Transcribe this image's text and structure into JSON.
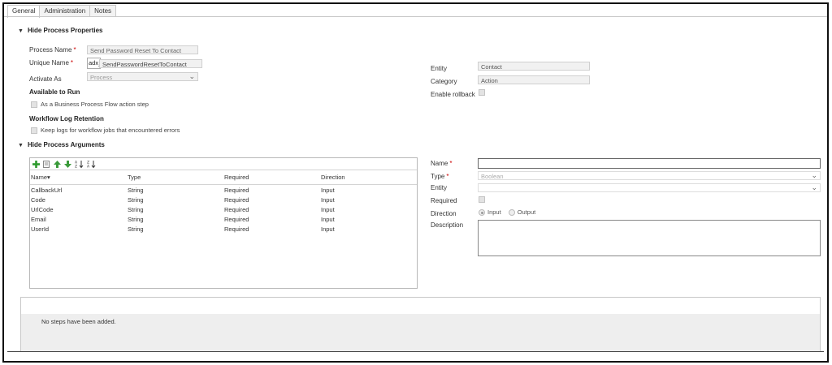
{
  "tabs": [
    {
      "label": "General"
    },
    {
      "label": "Administration"
    },
    {
      "label": "Notes"
    }
  ],
  "properties": {
    "header": "Hide Process Properties",
    "process_name": {
      "label": "Process Name",
      "value": "Send Password Reset To Contact"
    },
    "unique_name": {
      "label": "Unique Name",
      "prefix": "adx_",
      "value": "SendPasswordResetToContact"
    },
    "activate_as": {
      "label": "Activate As",
      "value": "Process"
    },
    "available_to_run": {
      "header": "Available to Run",
      "option": "As a Business Process Flow action step"
    },
    "workflow_log": {
      "header": "Workflow Log Retention",
      "option": "Keep logs for workflow jobs that encountered errors"
    },
    "entity": {
      "label": "Entity",
      "value": "Contact"
    },
    "category": {
      "label": "Category",
      "value": "Action"
    },
    "enable_rollback": {
      "label": "Enable rollback"
    }
  },
  "arguments": {
    "header": "Hide Process Arguments",
    "columns": [
      "Name",
      "Type",
      "Required",
      "Direction"
    ],
    "rows": [
      {
        "name": "CallbackUrl",
        "type": "String",
        "required": "Required",
        "direction": "Input"
      },
      {
        "name": "Code",
        "type": "String",
        "required": "Required",
        "direction": "Input"
      },
      {
        "name": "UrlCode",
        "type": "String",
        "required": "Required",
        "direction": "Input"
      },
      {
        "name": "Email",
        "type": "String",
        "required": "Required",
        "direction": "Input"
      },
      {
        "name": "UserId",
        "type": "String",
        "required": "Required",
        "direction": "Input"
      }
    ]
  },
  "detail": {
    "name_label": "Name",
    "type_label": "Type",
    "type_value": "Boolean",
    "entity_label": "Entity",
    "required_label": "Required",
    "direction_label": "Direction",
    "direction_input": "Input",
    "direction_output": "Output",
    "description_label": "Description"
  },
  "steps": {
    "empty_text": "No steps have been added."
  },
  "colors": {
    "required_star": "#cc0000",
    "add_icon": "#2e9b2e",
    "arrow_icon": "#3a9a3a"
  },
  "icons": [
    "add-icon",
    "edit-icon",
    "move-up-icon",
    "move-down-icon",
    "sort-ascending-icon",
    "sort-descending-icon",
    "chevron-down-icon",
    "collapse-caret-icon"
  ]
}
